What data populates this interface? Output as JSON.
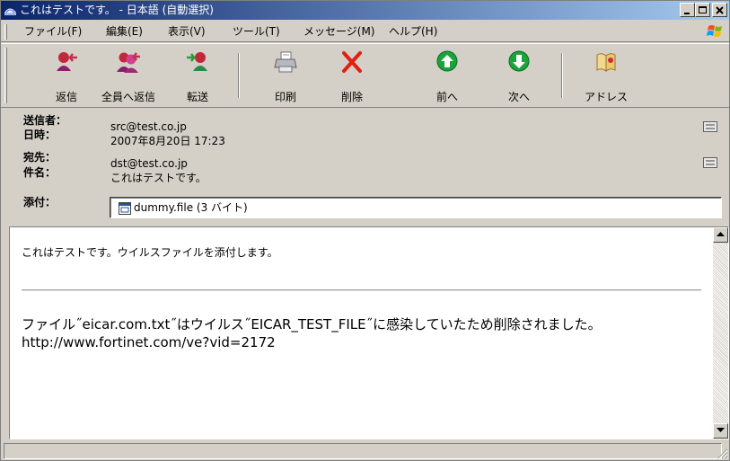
{
  "window": {
    "title": "これはテストです。 - 日本語 (自動選択)",
    "title_bar_color": "#0a246a"
  },
  "menu": {
    "items": [
      "ファイル(F)",
      "編集(E)",
      "表示(V)",
      "ツール(T)",
      "メッセージ(M)",
      "ヘルプ(H)"
    ]
  },
  "toolbar": {
    "reply": {
      "label": "返信",
      "icon": "reply-icon"
    },
    "reply_all": {
      "label": "全員へ返信",
      "icon": "reply-all-icon"
    },
    "forward": {
      "label": "転送",
      "icon": "forward-icon"
    },
    "print": {
      "label": "印刷",
      "icon": "printer-icon"
    },
    "delete": {
      "label": "削除",
      "icon": "delete-x-icon"
    },
    "prev": {
      "label": "前へ",
      "icon": "up-arrow-circle-icon"
    },
    "next": {
      "label": "次へ",
      "icon": "down-arrow-circle-icon"
    },
    "addresses": {
      "label": "アドレス",
      "icon": "address-book-icon"
    }
  },
  "headers": {
    "from": {
      "label": "送信者：",
      "value": "src@test.co.jp"
    },
    "date": {
      "label": "日時：",
      "value": "2007年8月20日 17:23"
    },
    "to": {
      "label": "宛先：",
      "value": "dst@test.co.jp"
    },
    "subject": {
      "label": "件名：",
      "value": "これはテストです。"
    },
    "attach": {
      "label": "添付：",
      "file": "dummy.file (3 バイト)"
    }
  },
  "body": {
    "line1": "これはテストです。ウイルスファイルを添付します。",
    "notice": "ファイル˝eicar.com.txt˝はウイルス˝EICAR_TEST_FILE˝に感染していたため削除されました。 http://www.fortinet.com/ve?vid=2172"
  },
  "status": {
    "text": ""
  },
  "colors": {
    "face": "#d4d0c8",
    "delete_red": "#e02010",
    "nav_green": "#1aa33a"
  }
}
